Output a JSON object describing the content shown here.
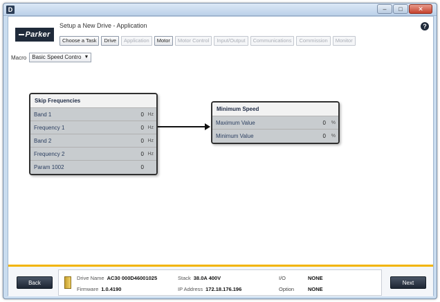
{
  "window": {
    "app_icon": "D",
    "controls": {
      "minimize": "–",
      "maximize": "□",
      "close": "✕"
    }
  },
  "header": {
    "logo_text": "Parker",
    "wizard_title": "Setup a New Drive - Application",
    "steps": [
      {
        "label": "Choose a Task",
        "enabled": true
      },
      {
        "label": "Drive",
        "enabled": true
      },
      {
        "label": "Application",
        "enabled": false
      },
      {
        "label": "Motor",
        "enabled": true
      },
      {
        "label": "Motor Control",
        "enabled": false
      },
      {
        "label": "Input/Output",
        "enabled": false
      },
      {
        "label": "Communications",
        "enabled": false
      },
      {
        "label": "Commission",
        "enabled": false
      },
      {
        "label": "Monitor",
        "enabled": false
      }
    ],
    "help_icon": "?"
  },
  "macro": {
    "label": "Macro",
    "selected": "Basic Speed Contro",
    "arrow": "▼"
  },
  "diagram": {
    "skip_frequencies": {
      "title": "Skip Frequencies",
      "rows": [
        {
          "name": "Band 1",
          "value": "0",
          "unit": "Hz"
        },
        {
          "name": "Frequency 1",
          "value": "0",
          "unit": "Hz"
        },
        {
          "name": "Band 2",
          "value": "0",
          "unit": "Hz"
        },
        {
          "name": "Frequency 2",
          "value": "0",
          "unit": "Hz"
        },
        {
          "name": "Param 1002",
          "value": "0",
          "unit": ""
        }
      ]
    },
    "minimum_speed": {
      "title": "Minimum Speed",
      "rows": [
        {
          "name": "Maximum Value",
          "value": "0",
          "unit": "%"
        },
        {
          "name": "Minimum Value",
          "value": "0",
          "unit": "%"
        }
      ]
    }
  },
  "footer": {
    "back_label": "Back",
    "next_label": "Next",
    "drive_name_label": "Drive Name",
    "drive_name_value": "AC30 000D46001025",
    "firmware_label": "Firmware",
    "firmware_value": "1.0.4190",
    "stack_label": "Stack",
    "stack_value": "38.0A 400V",
    "ip_label": "IP Address",
    "ip_value": "172.18.176.196",
    "io_label": "I/O",
    "io_value": "NONE",
    "option_label": "Option",
    "option_value": "NONE"
  },
  "colors": {
    "footer_accent": "#f2b400",
    "block_border": "#2f2f2f",
    "row_fill": "#c8cccf"
  }
}
